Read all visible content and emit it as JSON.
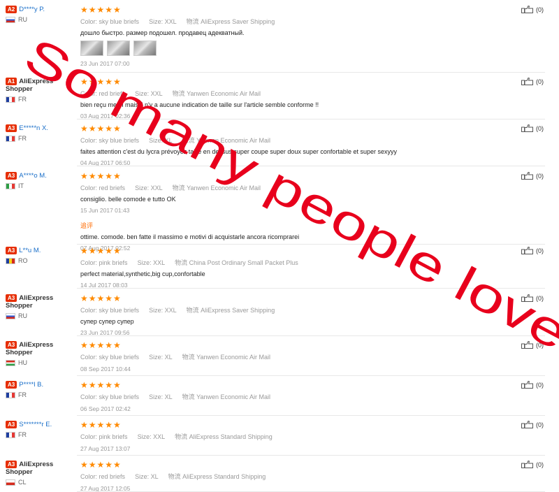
{
  "labels": {
    "color": "Color:",
    "size": "Size:",
    "shipping": "物流"
  },
  "reviews": [
    {
      "badge": "A2",
      "user": "D****y P.",
      "link": true,
      "country": "RU",
      "stars": "★★★★★",
      "color": "sky blue briefs",
      "size": "XXL",
      "shipping": "AliExpress Saver Shipping",
      "text": "дошло быстро. размер подошел. продавец адекватный.",
      "photos": 3,
      "date": "23 Jun 2017 07:00",
      "helpful": "(0)"
    },
    {
      "badge": "A1",
      "user": "AliExpress Shopper",
      "link": false,
      "country": "FR",
      "stars": "★★★★★",
      "color": "red briefs",
      "size": "XXL",
      "shipping": "Yanwen Economic Air Mail",
      "text": "bien reçu merci mais il n'y a aucune indication de taille sur l'article semble conforme !!",
      "date": "03 Aug 2017 02:36",
      "helpful": "(0)"
    },
    {
      "badge": "A3",
      "user": "E*****n X.",
      "link": true,
      "country": "FR",
      "stars": "★★★★★",
      "color": "sky blue briefs",
      "size": "XL",
      "shipping": "Yanwen Economic Air Mail",
      "text": "faites attention c'est du lycra prévoyez taille en dessus super coupe super doux super confortable et super sexyyy",
      "date": "04 Aug 2017 06:50",
      "helpful": "(0)"
    },
    {
      "badge": "A3",
      "user": "A****o M.",
      "link": true,
      "country": "IT",
      "stars": "★★★★★",
      "color": "red briefs",
      "size": "XXL",
      "shipping": "Yanwen Economic Air Mail",
      "text": "consiglio. belle comode e tutto OK",
      "date": "15 Jun 2017 01:43",
      "followup_label": "追评",
      "followup_text": "ottime. comode. ben fatte il massimo e motivi di acquistarle ancora ricomprarei",
      "followup_date": "07 Aug 2017 02:52",
      "helpful": "(0)"
    },
    {
      "badge": "A3",
      "user": "L**u M.",
      "link": true,
      "country": "RO",
      "stars": "★★★★★",
      "color": "pink briefs",
      "size": "XXL",
      "shipping": "China Post Ordinary Small Packet Plus",
      "text": "perfect material,synthetic,big cup,confortable",
      "date": "14 Jul 2017 08:03",
      "helpful": "(0)"
    },
    {
      "badge": "A3",
      "user": "AliExpress Shopper",
      "link": false,
      "country": "RU",
      "stars": "★★★★★",
      "color": "sky blue briefs",
      "size": "XXL",
      "shipping": "AliExpress Saver Shipping",
      "text": "супер супер супер",
      "date": "23 Jun 2017 09:56",
      "helpful": "(0)"
    },
    {
      "badge": "A3",
      "user": "AliExpress Shopper",
      "link": false,
      "country": "HU",
      "stars": "★★★★★",
      "color": "sky blue briefs",
      "size": "XL",
      "shipping": "Yanwen Economic Air Mail",
      "date": "08 Sep 2017 10:44",
      "helpful": "(0)"
    },
    {
      "badge": "A3",
      "user": "P****l B.",
      "link": true,
      "country": "FR",
      "stars": "★★★★★",
      "color": "sky blue briefs",
      "size": "XL",
      "shipping": "Yanwen Economic Air Mail",
      "date": "06 Sep 2017 02:42",
      "helpful": "(0)"
    },
    {
      "badge": "A3",
      "user": "S*******r E.",
      "link": true,
      "country": "FR",
      "stars": "★★★★★",
      "color": "pink briefs",
      "size": "XXL",
      "shipping": "AliExpress Standard Shipping",
      "date": "27 Aug 2017 13:07",
      "helpful": "(0)"
    },
    {
      "badge": "A3",
      "user": "AliExpress Shopper",
      "link": false,
      "country": "CL",
      "stars": "★★★★★",
      "color": "red briefs",
      "size": "XL",
      "shipping": "AliExpress Standard Shipping",
      "date": "27 Aug 2017 12:05",
      "helpful": "(0)"
    }
  ],
  "overlay": {
    "text": "So many people love it",
    "color": "#e8001c"
  }
}
